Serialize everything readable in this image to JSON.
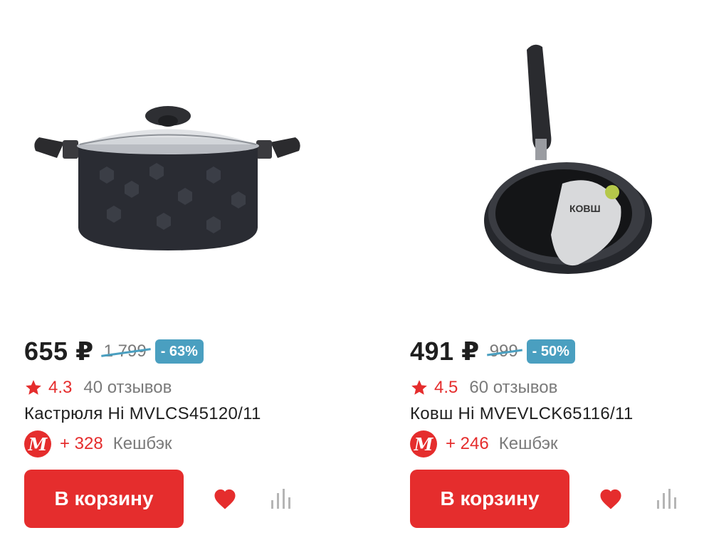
{
  "products": [
    {
      "image_alt": "Кастрюля",
      "price": "655 ₽",
      "old_price": "1 799",
      "discount": "- 63%",
      "rating": "4.3",
      "reviews": "40 отзывов",
      "title": "Кастрюля Hi MVLCS45120/11",
      "cashback_value": "+ 328",
      "cashback_label": "Кешбэк",
      "cart_label": "В корзину"
    },
    {
      "image_alt": "Ковш",
      "price": "491 ₽",
      "old_price": "999",
      "discount": "- 50%",
      "rating": "4.5",
      "reviews": "60 отзывов",
      "title": "Ковш Hi MVEVLCK65116/11",
      "cashback_value": "+ 246",
      "cashback_label": "Кешбэк",
      "cart_label": "В корзину"
    }
  ],
  "brand_logo_letter": "М",
  "packaging_text": "КОВШ",
  "colors": {
    "accent_red": "#e52d2d",
    "discount_blue": "#4a9fc0",
    "muted_text": "#7a7a7a"
  },
  "icons": {
    "rating": "star-icon",
    "favorite": "heart-icon",
    "compare": "compare-bars-icon",
    "cashback": "mvideo-logo-icon"
  }
}
